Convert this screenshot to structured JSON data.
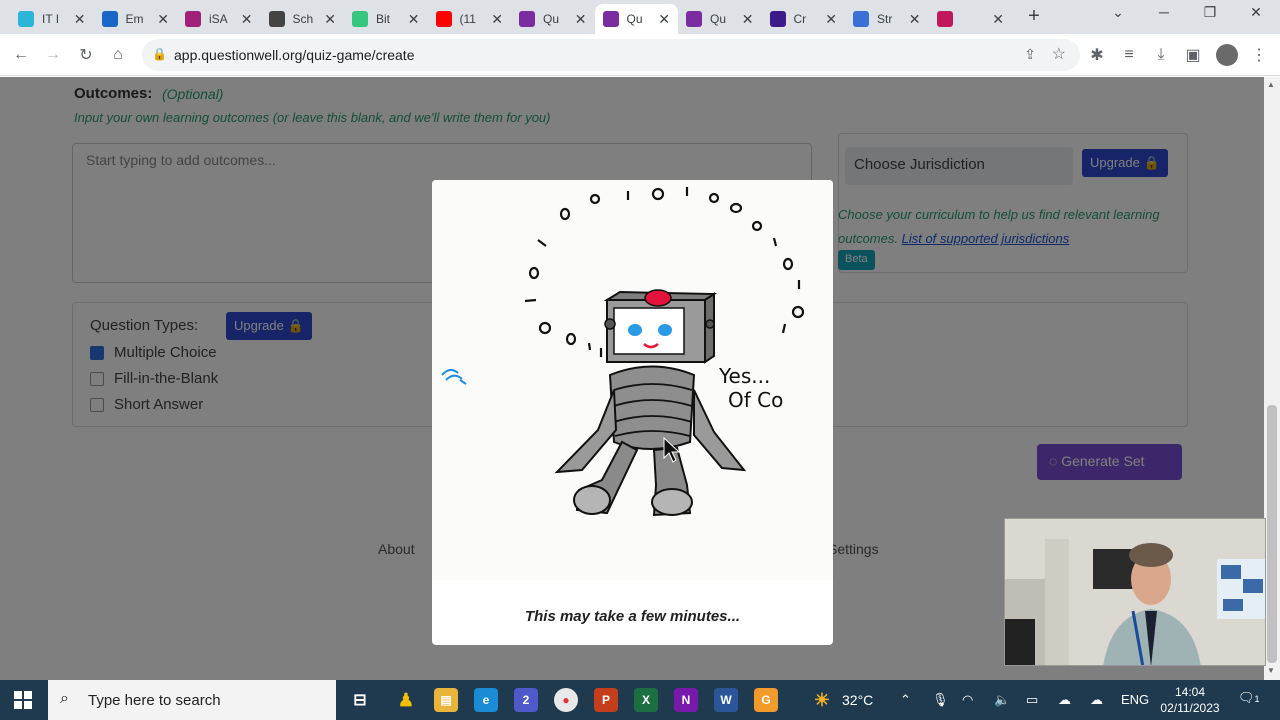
{
  "browser": {
    "tabs": [
      {
        "title": "IT I",
        "favicon_color": "#2bb6d8"
      },
      {
        "title": "Em",
        "favicon_color": "#1a66c7"
      },
      {
        "title": "iSA",
        "favicon_color": "#a0207a"
      },
      {
        "title": "Sch",
        "favicon_color": "#444444"
      },
      {
        "title": "Bit",
        "favicon_color": "#36c77f"
      },
      {
        "title": "(11",
        "favicon_color": "#ff0000"
      },
      {
        "title": "Qu",
        "favicon_color": "#7b2ca0"
      },
      {
        "title": "Qu",
        "favicon_color": "#7b2ca0",
        "active": true
      },
      {
        "title": "Qu",
        "favicon_color": "#7b2ca0"
      },
      {
        "title": "Cr",
        "favicon_color": "#3b1a8a"
      },
      {
        "title": "Str",
        "favicon_color": "#3b6fd8"
      },
      {
        "title": "",
        "favicon_color": "#c2185b"
      }
    ],
    "url": "app.questionwell.org/quiz-game/create"
  },
  "page": {
    "outcomes_label": "Outcomes:",
    "optional_label": "(Optional)",
    "outcomes_help": "Input your own learning outcomes (or leave this blank, and we'll write them for you)",
    "outcomes_placeholder": "Start typing to add outcomes...",
    "jurisdiction_placeholder": "Choose Jurisdiction",
    "upgrade_label": "Upgrade 🔒",
    "jurisdiction_help": "Choose your curriculum to help us find relevant learning outcomes.",
    "jurisdiction_link": "List of supported jurisdictions",
    "beta_label": "Beta",
    "question_types_label": "Question Types:",
    "question_types": [
      {
        "label": "Multiple Choice",
        "checked": true
      },
      {
        "label": "Fill-in-the-Blank",
        "checked": false
      },
      {
        "label": "Short Answer",
        "checked": false
      }
    ],
    "generate_label": "Generate Set",
    "footer_left": "About",
    "footer_right": "Settings"
  },
  "modal": {
    "robot_speech_line1": "Yes...",
    "robot_speech_line2": "Of Co",
    "message": "This may take a few minutes..."
  },
  "taskbar": {
    "search_placeholder": "Type here to search",
    "teams_badge": "2",
    "weather": "32°C",
    "language": "ENG",
    "time": "14:04",
    "date": "02/11/2023",
    "notification_count": "1"
  }
}
